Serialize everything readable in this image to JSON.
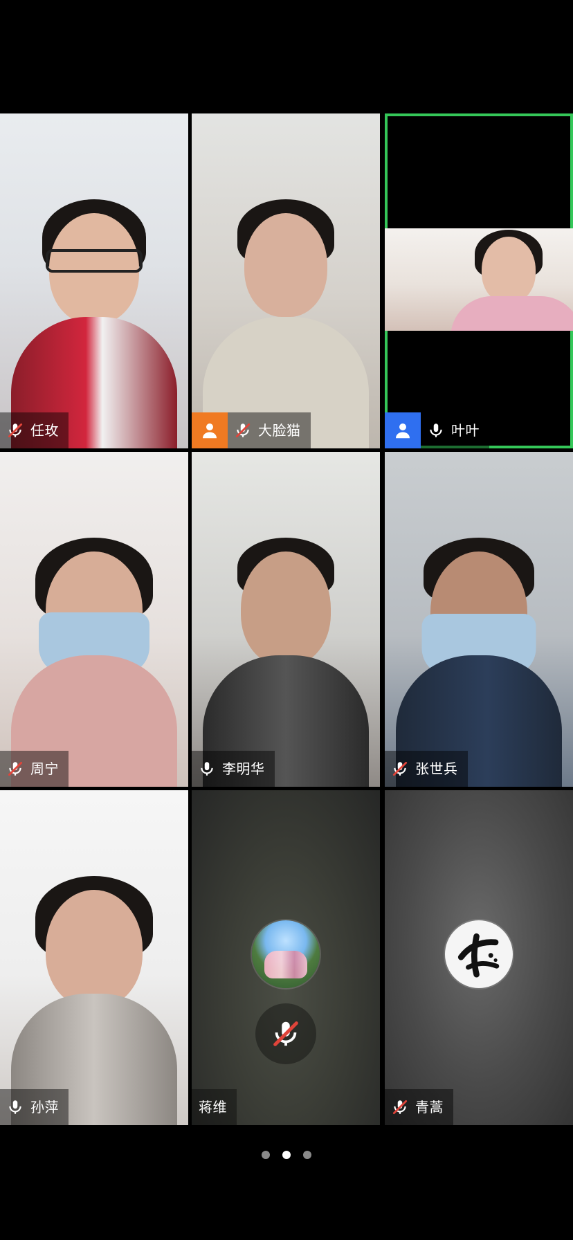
{
  "pager": {
    "total": 3,
    "current": 2
  },
  "participants": [
    {
      "id": "p1",
      "name": "任玫",
      "mic": "muted",
      "badge": null,
      "video": "on"
    },
    {
      "id": "p2",
      "name": "大脸猫",
      "mic": "muted",
      "badge": "host-orange",
      "video": "on"
    },
    {
      "id": "p3",
      "name": "叶叶",
      "mic": "on",
      "badge": "host-blue",
      "video": "inset",
      "active_speaker": true
    },
    {
      "id": "p4",
      "name": "周宁",
      "mic": "muted",
      "badge": null,
      "video": "on"
    },
    {
      "id": "p5",
      "name": "李明华",
      "mic": "on",
      "badge": null,
      "video": "on"
    },
    {
      "id": "p6",
      "name": "张世兵",
      "mic": "muted",
      "badge": null,
      "video": "on"
    },
    {
      "id": "p7",
      "name": "孙萍",
      "mic": "on",
      "badge": null,
      "video": "on"
    },
    {
      "id": "p8",
      "name": "蒋维",
      "mic": "muted",
      "badge": null,
      "video": "off",
      "avatar": "avatar-photo"
    },
    {
      "id": "p9",
      "name": "青蒿",
      "mic": "muted",
      "badge": null,
      "video": "off",
      "avatar": "calligraphy-avatar"
    }
  ],
  "colors": {
    "active_border": "#35c759",
    "badge_orange": "#f07a22",
    "badge_blue": "#2f6ff0",
    "muted_slash": "#e0443a"
  }
}
